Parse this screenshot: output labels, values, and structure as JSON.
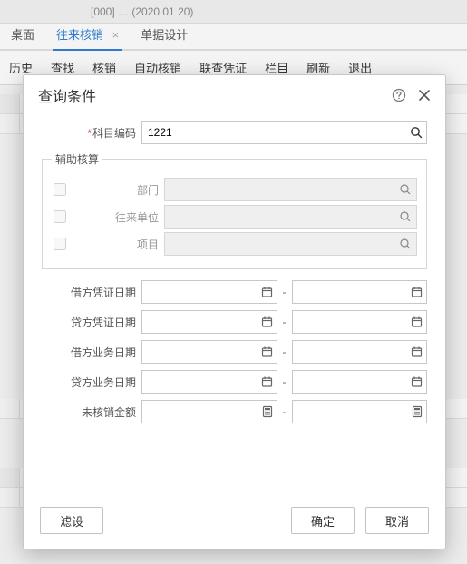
{
  "topbar_hint": "[000] …            (2020 01 20)",
  "tabs": {
    "t0": "桌面",
    "t1": "往来核销",
    "t2": "单据设计"
  },
  "toolbar": {
    "t0": "历史",
    "t1": "查找",
    "t2": "核销",
    "t3": "自动核销",
    "t4": "联查凭证",
    "t5": "栏目",
    "t6": "刷新",
    "t7": "退出"
  },
  "dialog": {
    "title": "查询条件",
    "subject_label": "科目编码",
    "subject_value": "1221",
    "aux_legend": "辅助核算",
    "aux": {
      "dept": "部门",
      "party": "往来单位",
      "project": "项目"
    },
    "ranges": {
      "debit_voucher_date": "借方凭证日期",
      "credit_voucher_date": "贷方凭证日期",
      "debit_biz_date": "借方业务日期",
      "credit_biz_date": "贷方业务日期",
      "unreconciled_amount": "未核销金额"
    },
    "buttons": {
      "filter": "滤设",
      "ok": "确定",
      "cancel": "取消"
    }
  }
}
